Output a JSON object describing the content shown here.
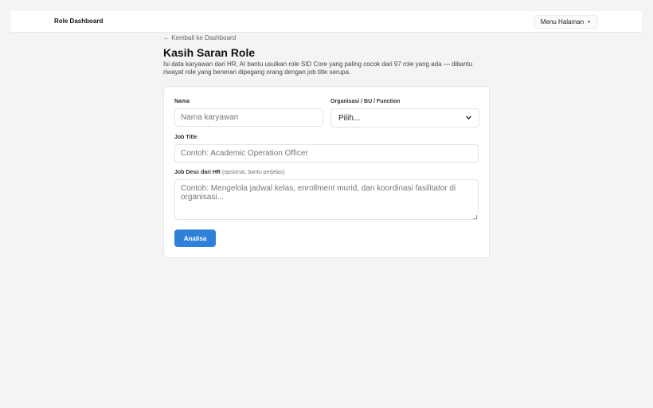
{
  "header": {
    "brand": "Role Dashboard",
    "menu_label": "Menu Halaman"
  },
  "page": {
    "back_link": "← Kembali ke Dashboard",
    "title": "Kasih Saran Role",
    "description": "Isi data karyawan dari HR, AI bantu usulkan role SID Core yang paling cocok dari 97 role yang ada — dibantu riwayat role yang beneran dipegang orang dengan job title serupa."
  },
  "form": {
    "name_label": "Nama",
    "name_placeholder": "Nama karyawan",
    "org_label": "Organisasi / BU / Function",
    "org_selected": "Pilih...",
    "jobtitle_label": "Job Title",
    "jobtitle_placeholder": "Contoh: Academic Operation Officer",
    "jobdesc_label": "Job Desc dari HR",
    "jobdesc_hint": "(opsional, bantu perjelas)",
    "jobdesc_placeholder": "Contoh: Mengelola jadwal kelas, enrollment murid, dan koordinasi fasilitator di organisasi...",
    "submit_label": "Analisa"
  },
  "colors": {
    "accent": "#2f80d8",
    "background": "#f4f4f4"
  }
}
